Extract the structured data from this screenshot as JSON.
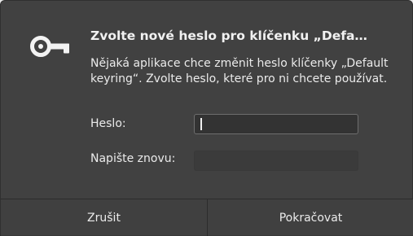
{
  "dialog": {
    "title": "Zvolte nové heslo pro klíčenku „Defa…",
    "message": "Nějaká aplikace chce změnit heslo klíčenky „Default keyring“. Zvolte heslo, které pro ni chcete používat.",
    "password_label": "Heslo:",
    "password_value": "",
    "confirm_label": "Napište znovu:",
    "confirm_value": "",
    "icon": "key-icon"
  },
  "buttons": {
    "cancel_label": "Zrušit",
    "ok_label": "Pokračovat"
  }
}
